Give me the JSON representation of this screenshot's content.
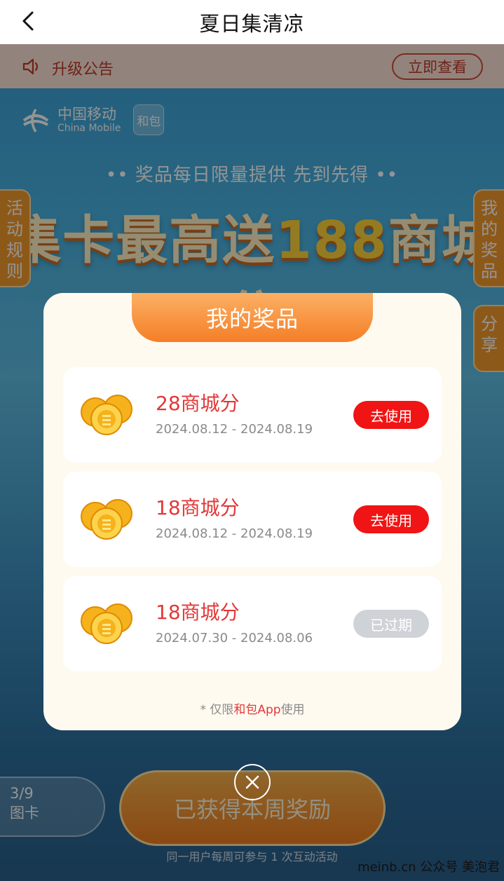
{
  "nav": {
    "title": "夏日集清凉"
  },
  "notice": {
    "label": "升级公告",
    "button": "立即查看"
  },
  "brand": {
    "cn": "中国移动",
    "en": "China Mobile",
    "hebao": "和包"
  },
  "banner": {
    "limited": "•• 奖品每日限量提供 先到先得 ••",
    "headline_a": "集卡最高送",
    "headline_num": "188",
    "headline_b": "商城分"
  },
  "side": {
    "rules": "活动规则",
    "prizes": "我的奖品",
    "share": "分享"
  },
  "bottom": {
    "progress_count": "3/9",
    "progress_label": "图卡",
    "main_button": "已获得本周奖励",
    "footnote": "同一用户每周可参与 1 次互动活动"
  },
  "modal": {
    "title": "我的奖品",
    "prizes": [
      {
        "name": "28商城分",
        "date": "2024.08.12 - 2024.08.19",
        "action": "去使用",
        "status": "active"
      },
      {
        "name": "18商城分",
        "date": "2024.08.12 - 2024.08.19",
        "action": "去使用",
        "status": "active"
      },
      {
        "name": "18商城分",
        "date": "2024.07.30 - 2024.08.06",
        "action": "已过期",
        "status": "expired"
      }
    ],
    "limit_prefix": "* 仅限",
    "limit_app": "和包App",
    "limit_suffix": "使用"
  },
  "watermark": "meinb.cn 公众号 美泡君",
  "colors": {
    "accent_red": "#e23838",
    "button_red": "#f01414",
    "tab_orange": "#f57e27",
    "expired_gray": "#cfd3d8"
  }
}
